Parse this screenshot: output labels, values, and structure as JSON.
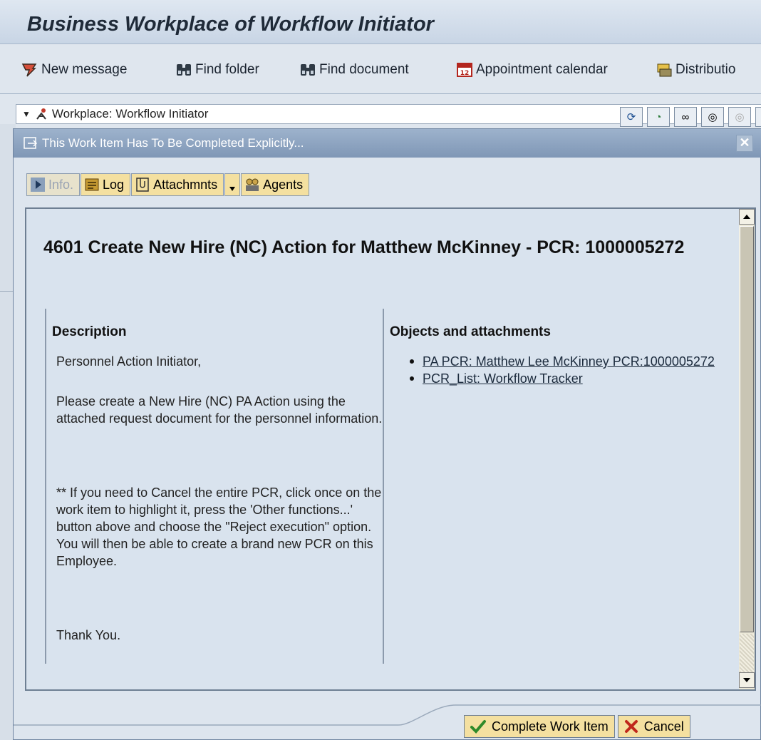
{
  "window": {
    "title": "Business Workplace of Workflow Initiator"
  },
  "toolbar": {
    "items": [
      {
        "label": "New message",
        "icon": "new-message-icon"
      },
      {
        "label": "Find folder",
        "icon": "binoculars-icon"
      },
      {
        "label": "Find document",
        "icon": "binoculars-icon"
      },
      {
        "label": "Appointment calendar",
        "icon": "calendar-icon"
      },
      {
        "label": "Distributio",
        "icon": "distribution-icon"
      }
    ]
  },
  "tree": {
    "node_label": "Workplace: Workflow Initiator"
  },
  "dialog": {
    "title": "This Work Item Has To Be Completed Explicitly...",
    "buttons": {
      "info": "Info.",
      "log": "Log",
      "attachments": "Attachmnts",
      "agents": "Agents"
    },
    "work_item_title": "4601 Create New Hire (NC) Action for Matthew McKinney - PCR: 1000005272",
    "description": {
      "heading": "Description",
      "paragraphs": [
        "Personnel Action Initiator,",
        "Please create a New Hire (NC) PA Action using the attached request document for the personnel information.",
        "** If you need to Cancel the entire PCR, click once on the work item to highlight it, press the 'Other functions...' button above and choose the \"Reject execution\" option. You will then be able to create a brand new PCR on this Employee.",
        "Thank You."
      ]
    },
    "objects": {
      "heading": "Objects and attachments",
      "links": [
        "PA PCR: Matthew Lee McKinney PCR:1000005272",
        "PCR_List: Workflow Tracker"
      ]
    },
    "footer": {
      "complete": "Complete Work Item",
      "cancel": "Cancel"
    }
  },
  "colors": {
    "accent": "#f4e0a0",
    "dialog_title": "#8aa1bf",
    "background": "#dfe6ee"
  }
}
